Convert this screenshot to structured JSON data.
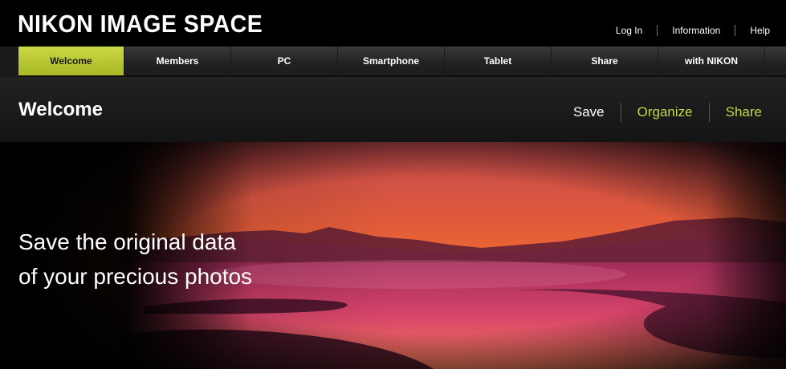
{
  "header": {
    "logo": "NIKON IMAGE SPACE",
    "links": [
      "Log In",
      "Information",
      "Help"
    ]
  },
  "nav": {
    "tabs": [
      "Welcome",
      "Members",
      "PC",
      "Smartphone",
      "Tablet",
      "Share",
      "with NIKON"
    ],
    "active": "Welcome"
  },
  "section": {
    "title": "Welcome",
    "links": [
      "Save",
      "Organize",
      "Share"
    ],
    "current": "Save"
  },
  "hero": {
    "line1": "Save the original data",
    "line2": "of your precious photos"
  },
  "colors": {
    "accent": "#c8d44a",
    "background": "#000000"
  }
}
